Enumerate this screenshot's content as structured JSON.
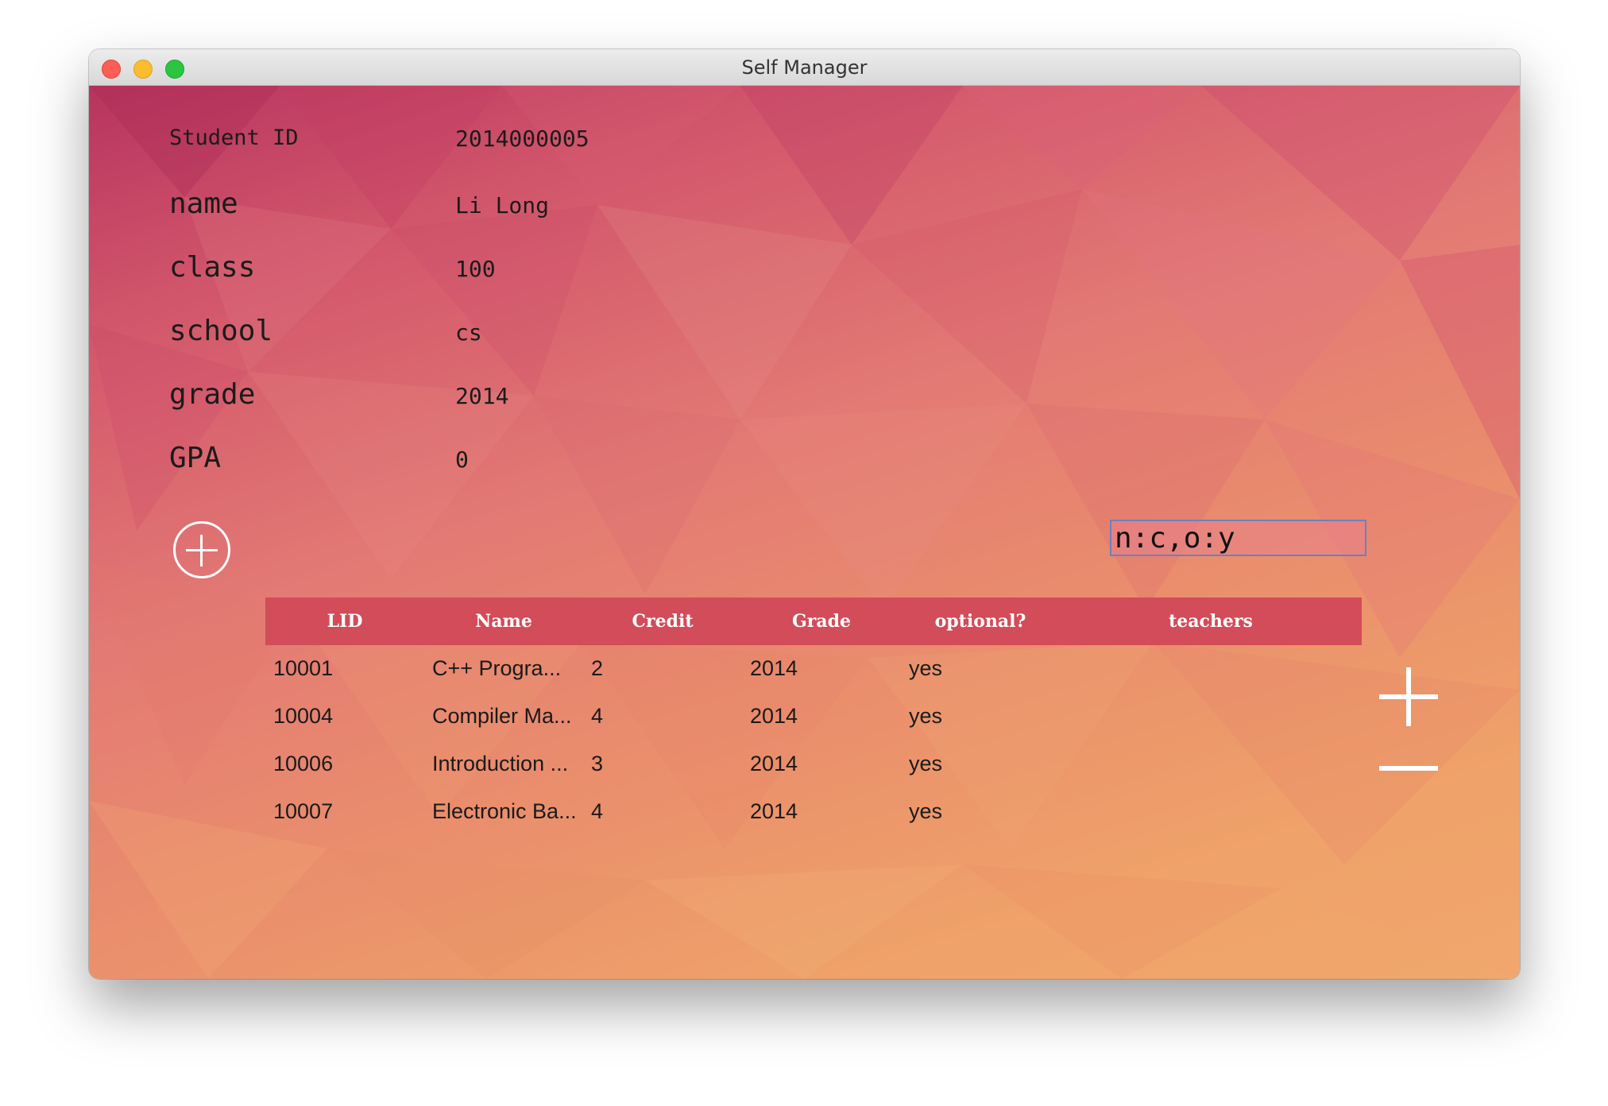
{
  "window": {
    "title": "Self Manager"
  },
  "student": {
    "fields": [
      {
        "label": "Student ID",
        "value": "2014000005"
      },
      {
        "label": "name",
        "value": "Li Long"
      },
      {
        "label": "class",
        "value": "100"
      },
      {
        "label": "school",
        "value": "cs"
      },
      {
        "label": "grade",
        "value": "2014"
      },
      {
        "label": "GPA",
        "value": "0"
      }
    ]
  },
  "filter": {
    "value": "n:c,o:y"
  },
  "table": {
    "columns": [
      "LID",
      "Name",
      "Credit",
      "Grade",
      "optional?",
      "teachers"
    ],
    "rows": [
      [
        "10001",
        "C++ Progra...",
        "2",
        "2014",
        "yes",
        ""
      ],
      [
        "10004",
        "Compiler Ma...",
        "4",
        "2014",
        "yes",
        ""
      ],
      [
        "10006",
        "Introduction ...",
        "3",
        "2014",
        "yes",
        ""
      ],
      [
        "10007",
        "Electronic Ba...",
        "4",
        "2014",
        "yes",
        ""
      ]
    ]
  },
  "icons": {
    "add_student": "circle-plus-icon",
    "add_row": "plus-icon",
    "remove_row": "minus-icon"
  }
}
